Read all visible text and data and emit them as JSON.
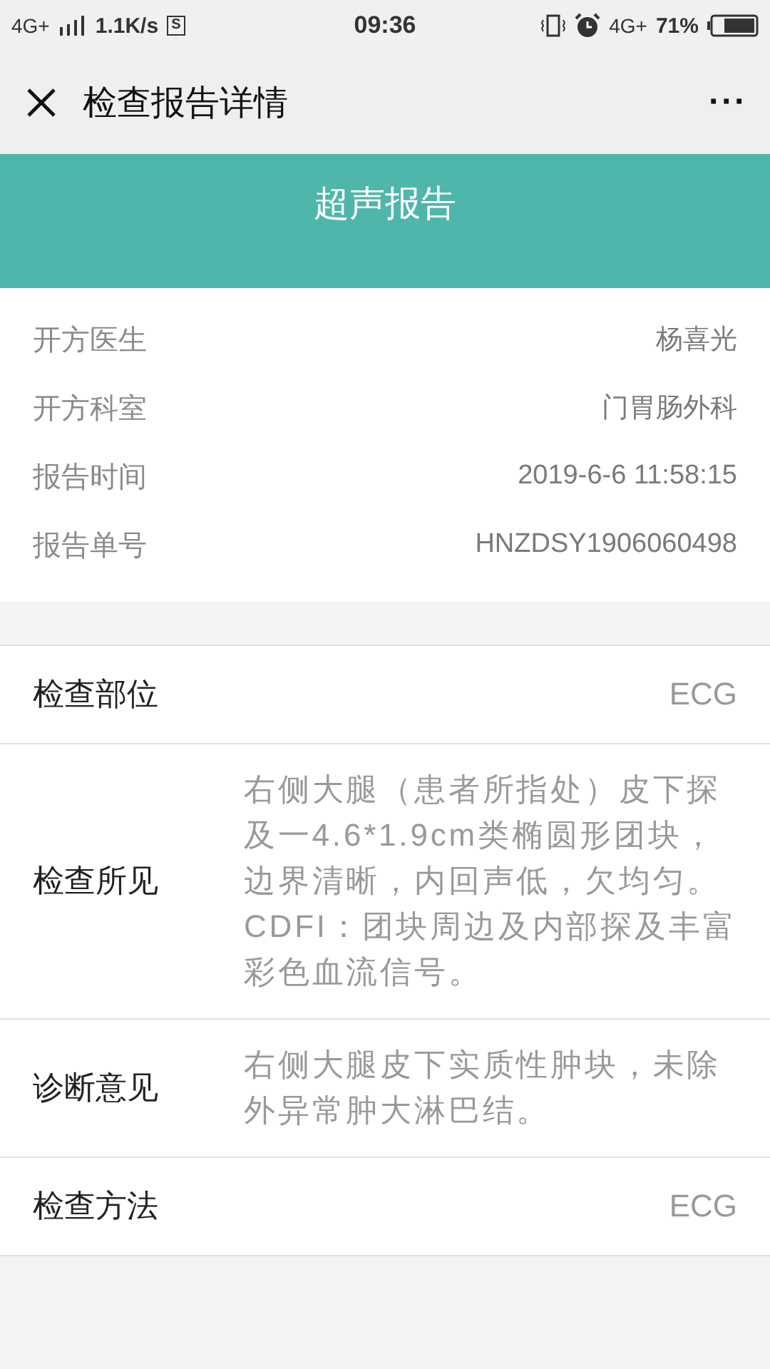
{
  "status_bar": {
    "network": "4G+",
    "speed": "1.1K/s",
    "sim_badge": "S",
    "time": "09:36",
    "network_right": "4G+",
    "battery": "71%"
  },
  "nav": {
    "title": "检查报告详情",
    "more": "···"
  },
  "banner": {
    "title": "超声报告"
  },
  "info": [
    {
      "label": "开方医生",
      "value": "杨喜光"
    },
    {
      "label": "开方科室",
      "value": "门胃肠外科"
    },
    {
      "label": "报告时间",
      "value": "2019-6-6 11:58:15"
    },
    {
      "label": "报告单号",
      "value": "HNZDSY1906060498"
    }
  ],
  "details": [
    {
      "label": "检查部位",
      "value": "ECG",
      "kind": "short"
    },
    {
      "label": "检查所见",
      "value": "右侧大腿（患者所指处）皮下探及一4.6*1.9cm类椭圆形团块，边界清晰，内回声低，欠均匀。CDFI：团块周边及内部探及丰富彩色血流信号。",
      "kind": "long"
    },
    {
      "label": "诊断意见",
      "value": "右侧大腿皮下实质性肿块，未除外异常肿大淋巴结。",
      "kind": "long"
    },
    {
      "label": "检查方法",
      "value": "ECG",
      "kind": "short"
    }
  ]
}
